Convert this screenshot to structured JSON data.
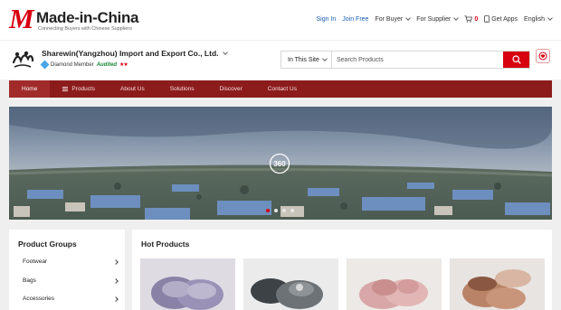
{
  "header": {
    "logo": {
      "mark": "M",
      "name": "Made-in-China",
      "tagline": "Connecting Buyers with Chinese Suppliers"
    },
    "links": {
      "sign_in": "Sign In",
      "join_free": "Join Free",
      "for_buyer": "For Buyer",
      "for_supplier": "For Supplier",
      "cart_count": "0",
      "get_apps": "Get Apps",
      "language": "English"
    }
  },
  "company": {
    "name": "Sharewin(Yangzhou) Import and Export Co., Ltd.",
    "membership": "Diamond Member",
    "audited": "Audited",
    "stars": "★★"
  },
  "search": {
    "scope": "In This Site",
    "placeholder": "Search Products"
  },
  "nav": {
    "items": [
      "Home",
      "Products",
      "About Us",
      "Solutions",
      "Discover",
      "Contact Us"
    ],
    "active": "Home"
  },
  "banner": {
    "pano_label": "360",
    "slide_count": 4,
    "active_slide": 1
  },
  "product_groups": {
    "title": "Product Groups",
    "items": [
      "Footwear",
      "Bags",
      "Accessories"
    ]
  },
  "hot_products": {
    "title": "Hot Products"
  },
  "colors": {
    "brand_red": "#d6000f",
    "nav_bg": "#8c1c1c",
    "link_blue": "#1a5fb4"
  }
}
